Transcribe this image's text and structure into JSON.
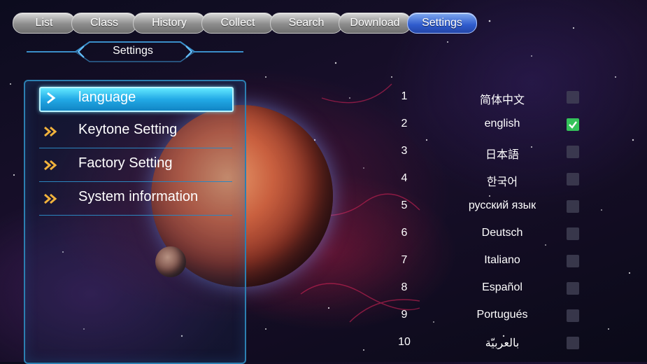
{
  "tabs": [
    {
      "label": "List",
      "active": false
    },
    {
      "label": "Class",
      "active": false
    },
    {
      "label": "History",
      "active": false
    },
    {
      "label": "Collect",
      "active": false
    },
    {
      "label": "Search",
      "active": false
    },
    {
      "label": "Download",
      "active": false
    },
    {
      "label": "Settings",
      "active": true
    }
  ],
  "header": {
    "title": "Settings"
  },
  "menu": {
    "items": [
      {
        "label": "language",
        "selected": true
      },
      {
        "label": "Keytone Setting",
        "selected": false
      },
      {
        "label": "Factory Setting",
        "selected": false
      },
      {
        "label": "System information",
        "selected": false
      }
    ]
  },
  "languages": [
    {
      "num": "1",
      "name": "简体中文",
      "checked": false
    },
    {
      "num": "2",
      "name": "english",
      "checked": true
    },
    {
      "num": "3",
      "name": "日本語",
      "checked": false
    },
    {
      "num": "4",
      "name": "한국어",
      "checked": false
    },
    {
      "num": "5",
      "name": "русский язык",
      "checked": false
    },
    {
      "num": "6",
      "name": "Deutsch",
      "checked": false
    },
    {
      "num": "7",
      "name": "Italiano",
      "checked": false
    },
    {
      "num": "8",
      "name": "Español",
      "checked": false
    },
    {
      "num": "9",
      "name": "Portugués",
      "checked": false
    },
    {
      "num": "10",
      "name": "بالعربيّة",
      "checked": false
    }
  ],
  "colors": {
    "accent": "#2f5bcc",
    "highlight": "#22a9e6",
    "check": "#34c25a",
    "border": "#2c7fb1"
  },
  "icons": {
    "menu_arrow": "double-chevron-right-icon",
    "selected_arrow": "chevron-right-icon",
    "check": "checkmark-icon"
  }
}
